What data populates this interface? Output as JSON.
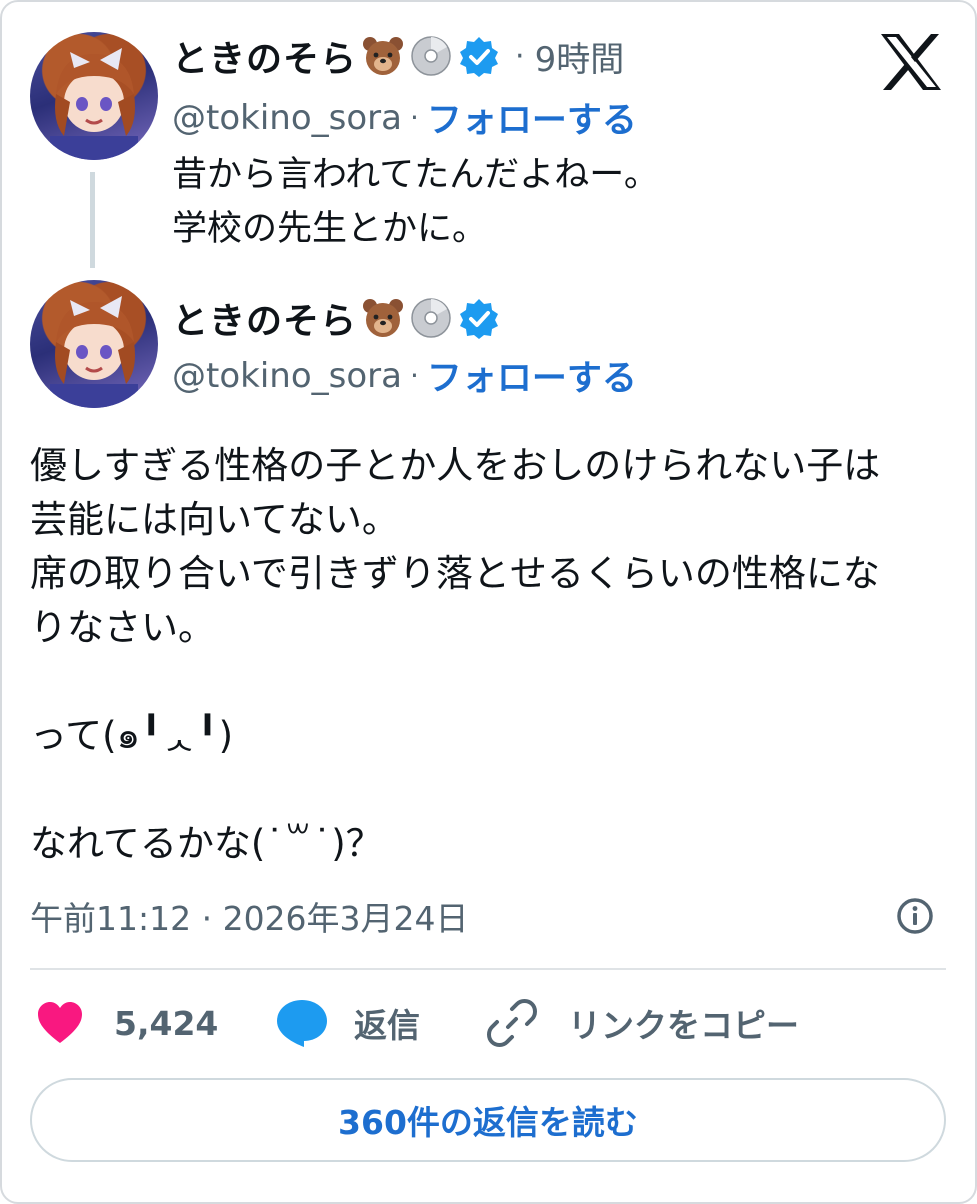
{
  "post_card": {
    "quoted": {
      "author_name": "ときのそら",
      "handle": "@tokino_sora",
      "time": "9時間",
      "follow_label": "フォローする",
      "text": "昔から言われてたんだよねー。\n学校の先生とかに。"
    },
    "main": {
      "author_name": "ときのそら",
      "handle": "@tokino_sora",
      "follow_label": "フォローする",
      "text": "優しすぎる性格の子とか人をおしのけられない子は\n芸能には向いてない。\n席の取り合いで引きずり落とせるくらいの性格にな\nりなさい。\n\nって(๑╹ᆺ╹)\n\nなれてるかな(˙꒳​˙)？",
      "timestamp": "午前11:12 · 2026年3月24日"
    },
    "separator": "·",
    "actions": {
      "like_count": "5,424",
      "reply_label": "返信",
      "copy_link_label": "リンクをコピー"
    },
    "read_replies_label": "360件の返信を読む"
  },
  "icons": {
    "emoji_1": "bear-face-icon",
    "emoji_2": "disc-icon",
    "verified": "verified-badge-icon",
    "logo": "x-logo-icon",
    "info": "info-icon",
    "like": "heart-icon",
    "reply": "speech-bubble-icon",
    "copy": "link-icon"
  },
  "colors": {
    "accent": "#1d6ecf",
    "verified": "#1d9bf0",
    "heart": "#f91880",
    "reply_bubble": "#1d9bf0",
    "muted": "#536471"
  }
}
